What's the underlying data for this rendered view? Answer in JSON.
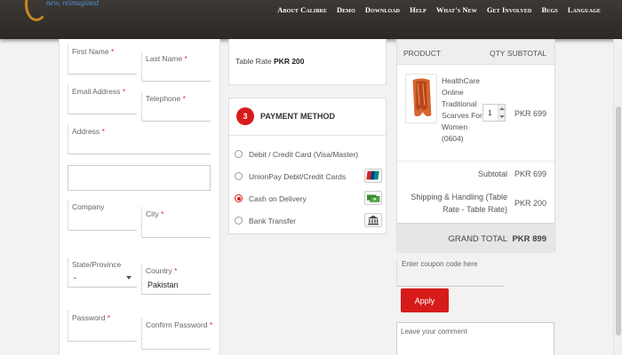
{
  "header": {
    "logo_text": "new, reimagined",
    "nav": [
      "About Calibre",
      "Demo",
      "Download",
      "Help",
      "What's New",
      "Get Involved",
      "Bugs",
      "Language"
    ]
  },
  "form": {
    "first_name": "First Name",
    "last_name": "Last Name",
    "email": "Email Address",
    "telephone": "Telephone",
    "address": "Address",
    "company": "Company",
    "city": "City",
    "state_label": "State/Province",
    "state_value": "-",
    "country_label": "Country",
    "country_value": "Pakistan",
    "password": "Password",
    "confirm_password": "Confirm Password",
    "required_mark": "*"
  },
  "shipping": {
    "label": "Table Rate",
    "price": "PKR 200"
  },
  "payment": {
    "step": "3",
    "title": "PAYMENT METHOD",
    "options": [
      {
        "label": "Debit / Credit Card (Visa/Master)",
        "selected": false,
        "icon": ""
      },
      {
        "label": "UnionPay Debit/Credit Cards",
        "selected": false,
        "icon": "unionpay-icon"
      },
      {
        "label": "Cash on Delivery",
        "selected": true,
        "icon": "cash-icon"
      },
      {
        "label": "Bank Transfer",
        "selected": false,
        "icon": "bank-icon"
      }
    ]
  },
  "summary": {
    "headers": {
      "product": "PRODUCT",
      "qty": "QTY",
      "subtotal": "SUBTOTAL"
    },
    "item": {
      "name_lines": [
        "HealthCare",
        "Online",
        "Traditional",
        "Scarves For",
        "Women",
        "(0604)"
      ],
      "qty": "1",
      "subtotal": "PKR 699"
    },
    "subtotal_label": "Subtotal",
    "subtotal_value": "PKR 699",
    "shipping_label_line1": "Shipping & Handling (Table",
    "shipping_label_line2": "Rate - Table Rate)",
    "shipping_value": "PKR 200",
    "grand_label": "GRAND TOTAL",
    "grand_value": "PKR 899"
  },
  "coupon": {
    "placeholder": "Enter coupon code here",
    "apply_label": "Apply"
  },
  "comment": {
    "placeholder": "Leave your comment"
  },
  "colors": {
    "accent": "#d71b1b",
    "header_bg": "#2f2b28",
    "link_logo": "#4e8fd8"
  }
}
